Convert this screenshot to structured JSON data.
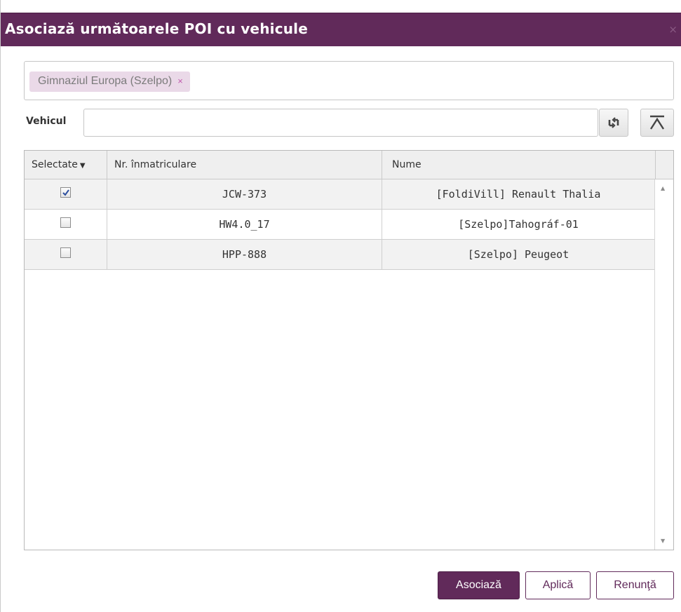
{
  "dialog": {
    "title": "Asociază următoarele POI cu vehicule",
    "close_glyph": "×"
  },
  "poi_selector": {
    "tags": [
      {
        "label": "Gimnaziul Europa (Szelpo)",
        "remove_glyph": "×"
      }
    ]
  },
  "vehicle_filter": {
    "label": "Vehicul",
    "value": "",
    "refresh_icon": "refresh-icon",
    "clear_icon": "clear-filter-icon"
  },
  "grid": {
    "columns": [
      "Selectate",
      "Nr. înmatriculare",
      "Nume"
    ],
    "sort_indicator": "▼",
    "rows": [
      {
        "selected": true,
        "plate": "JCW-373",
        "name": "[FoldiVill] Renault Thalia"
      },
      {
        "selected": false,
        "plate": "HW4.0_17",
        "name": "[Szelpo]Tahográf-01"
      },
      {
        "selected": false,
        "plate": "HPP-888",
        "name": "[Szelpo] Peugeot"
      }
    ]
  },
  "buttons": {
    "associate": "Asociază",
    "apply": "Aplică",
    "cancel": "Renunţă"
  },
  "colors": {
    "brand": "#612a5a",
    "tag_bg": "#ead9e8",
    "tag_remove": "#c15cae"
  }
}
